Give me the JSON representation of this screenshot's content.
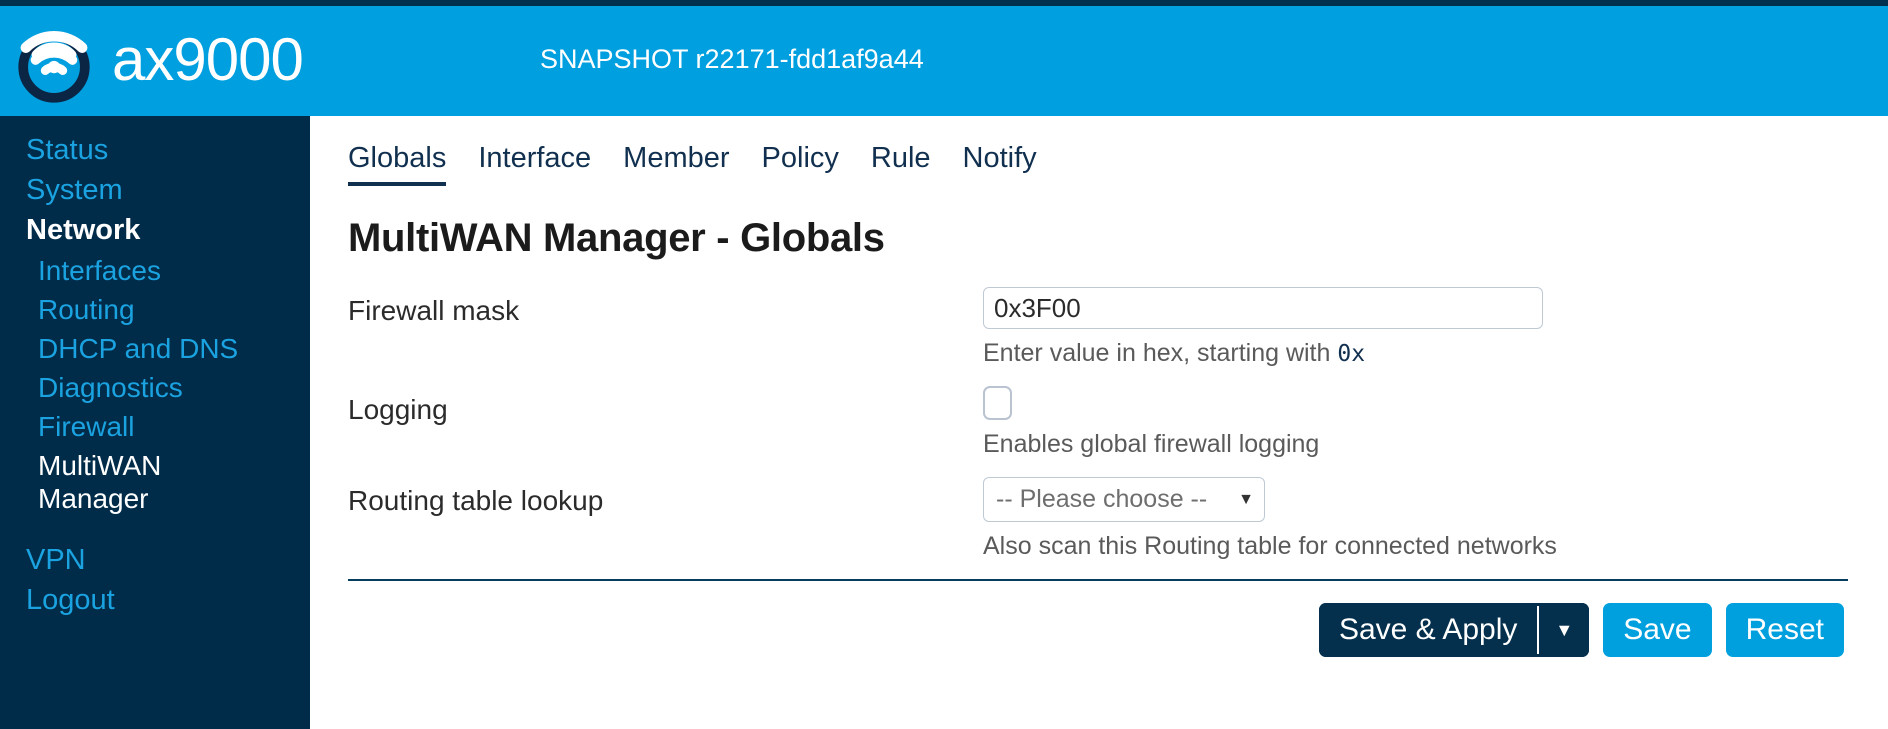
{
  "header": {
    "brand": "ax9000",
    "logo_icon": "wifi-signal-icon",
    "version": "SNAPSHOT r22171-fdd1af9a44",
    "bg_color": "#009fdf"
  },
  "sidebar": {
    "bg_color": "#002b49",
    "link_color": "#1aa3e0",
    "items": [
      {
        "label": "Status",
        "level": "top",
        "active": false
      },
      {
        "label": "System",
        "level": "top",
        "active": false
      },
      {
        "label": "Network",
        "level": "top",
        "active": true
      },
      {
        "label": "Interfaces",
        "level": "sub",
        "active": false
      },
      {
        "label": "Routing",
        "level": "sub",
        "active": false
      },
      {
        "label": "DHCP and DNS",
        "level": "sub",
        "active": false
      },
      {
        "label": "Diagnostics",
        "level": "sub",
        "active": false
      },
      {
        "label": "Firewall",
        "level": "sub",
        "active": false
      },
      {
        "label": "MultiWAN Manager",
        "level": "sub",
        "active": true
      },
      {
        "label": "VPN",
        "level": "top",
        "active": false
      },
      {
        "label": "Logout",
        "level": "top",
        "active": false
      }
    ]
  },
  "main": {
    "tabs": [
      {
        "label": "Globals",
        "active": true
      },
      {
        "label": "Interface",
        "active": false
      },
      {
        "label": "Member",
        "active": false
      },
      {
        "label": "Policy",
        "active": false
      },
      {
        "label": "Rule",
        "active": false
      },
      {
        "label": "Notify",
        "active": false
      }
    ],
    "page_title": "MultiWAN Manager - Globals",
    "fields": {
      "firewall_mask": {
        "label": "Firewall mask",
        "value": "0x3F00",
        "placeholder": "",
        "hint_before": "Enter value in hex, starting with ",
        "hint_code": "0x"
      },
      "logging": {
        "label": "Logging",
        "checked": false,
        "hint": "Enables global firewall logging"
      },
      "routing_table_lookup": {
        "label": "Routing table lookup",
        "selected": "-- Please choose --",
        "caret_icon": "chevron-down-icon",
        "hint": "Also scan this Routing table for connected networks"
      }
    },
    "actions": {
      "save_apply_label": "Save & Apply",
      "save_apply_caret_icon": "chevron-down-icon",
      "save_label": "Save",
      "reset_label": "Reset",
      "primary_color": "#00a0df",
      "dark_color": "#05304d"
    }
  }
}
